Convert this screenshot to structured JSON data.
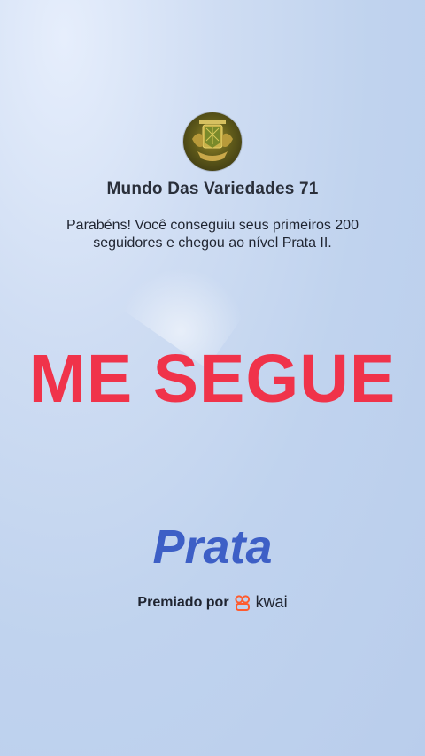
{
  "profile": {
    "name": "Mundo Das Variedades 71",
    "avatar_icon": "coat-of-arms-icon"
  },
  "message": "Parabéns! Você conseguiu seus primeiros 200 seguidores e chegou ao nível Prata II.",
  "headline": "ME SEGUE",
  "level": "Prata",
  "awarded": {
    "label": "Premiado por",
    "brand": "kwai",
    "brand_icon": "kwai-logo-icon"
  },
  "colors": {
    "headline": "#f0334a",
    "level": "#3d5fc6",
    "brand": "#ff5b2e"
  }
}
